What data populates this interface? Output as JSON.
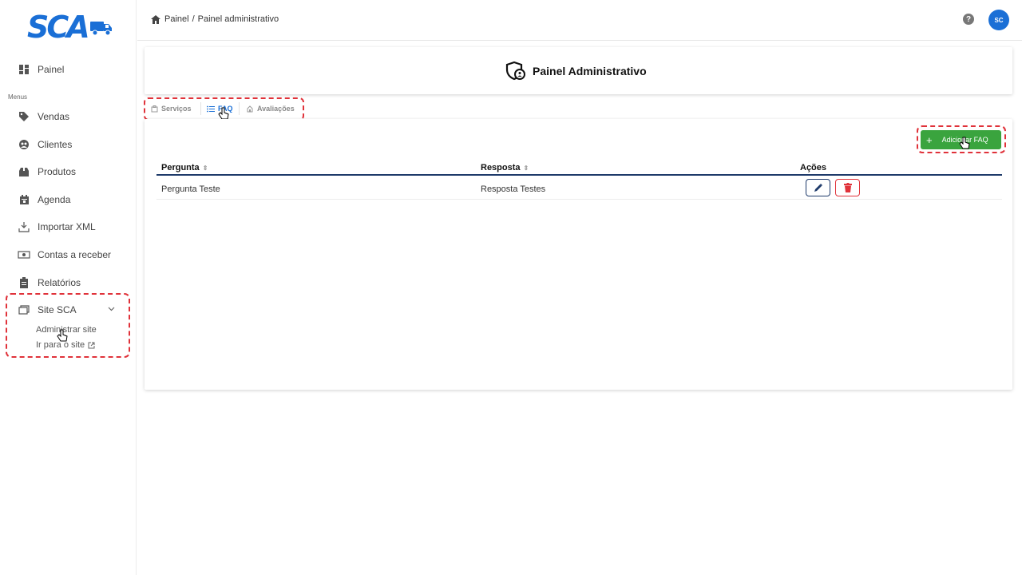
{
  "app": {
    "logo_text": "SCA",
    "brand_color": "#1a6fd6"
  },
  "sidebar": {
    "section_label": "Menus",
    "items": [
      {
        "label": "Painel",
        "icon": "dashboard-icon"
      },
      {
        "label": "Vendas",
        "icon": "tag-icon"
      },
      {
        "label": "Clientes",
        "icon": "clients-icon"
      },
      {
        "label": "Produtos",
        "icon": "package-icon"
      },
      {
        "label": "Agenda",
        "icon": "calendar-icon"
      },
      {
        "label": "Importar XML",
        "icon": "download-icon"
      },
      {
        "label": "Contas a receber",
        "icon": "money-icon"
      },
      {
        "label": "Relatórios",
        "icon": "clipboard-icon"
      },
      {
        "label": "Site SCA",
        "icon": "browser-icon"
      }
    ],
    "site_sub": [
      {
        "label": "Administrar site"
      },
      {
        "label": "Ir para o site"
      }
    ]
  },
  "header": {
    "breadcrumb": [
      "Painel",
      "/",
      "Painel administrativo"
    ],
    "avatar_initials": "SC",
    "help": "?"
  },
  "page": {
    "title": "Painel Administrativo"
  },
  "tabs": [
    {
      "label": "Serviços",
      "active": false
    },
    {
      "label": "FAQ",
      "active": true
    },
    {
      "label": "Avaliações",
      "active": false
    }
  ],
  "toolbar": {
    "add_label": "Adicionar FAQ",
    "add_color": "#3aa43e"
  },
  "table": {
    "columns": [
      "Pergunta",
      "Resposta",
      "Ações"
    ],
    "rows": [
      {
        "pergunta": "Pergunta Teste",
        "resposta": "Resposta Testes"
      }
    ]
  },
  "colors": {
    "highlight": "#e0323a",
    "delete": "#e0323a",
    "edit": "#1e3a6a"
  }
}
